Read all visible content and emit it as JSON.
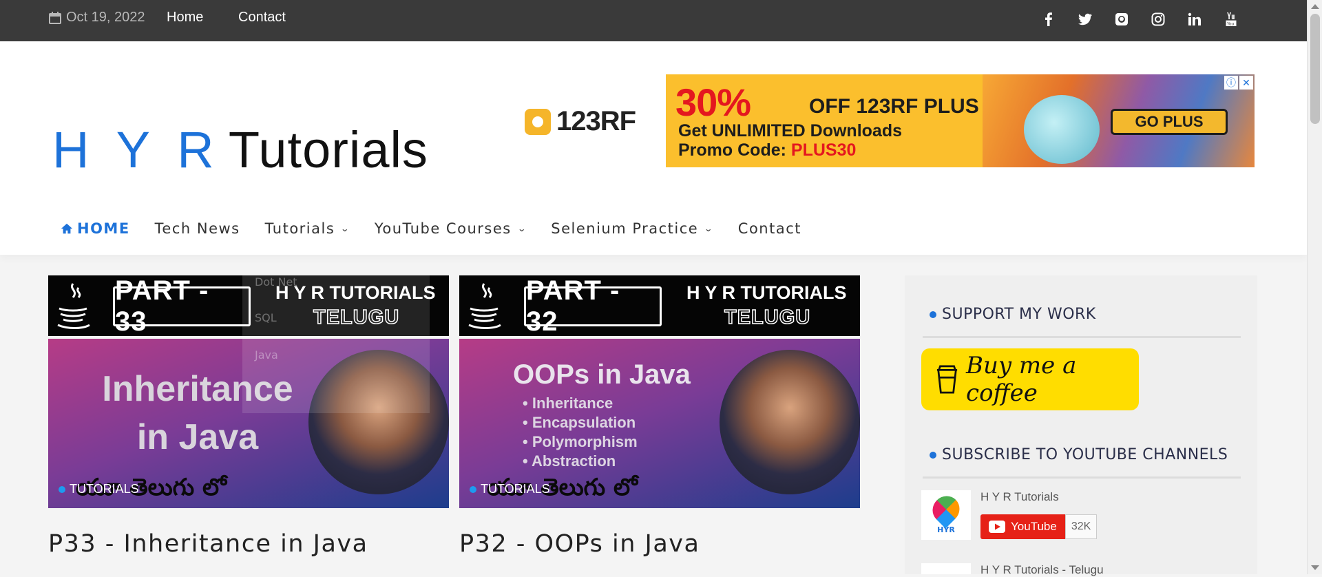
{
  "topbar": {
    "date": "Oct 19, 2022",
    "links": [
      "Home",
      "Contact"
    ],
    "social_icons": [
      "facebook-icon",
      "twitter-icon",
      "github-icon",
      "instagram-icon",
      "linkedin-icon",
      "youtube-icon"
    ]
  },
  "header": {
    "logo_hyr": "H Y R",
    "logo_tutorials": "Tutorials"
  },
  "ad": {
    "brand": "123RF",
    "discount": "30%",
    "offer": "OFF 123RF PLUS",
    "line2": "Get UNLIMITED Downloads",
    "line3_prefix": "Promo Code: ",
    "promo_code": "PLUS30",
    "cta": "GO PLUS",
    "info_icon": "ⓘ",
    "close_icon": "✕"
  },
  "nav": {
    "items": [
      {
        "label": "HOME",
        "icon": "home-icon",
        "active": true
      },
      {
        "label": "Tech News"
      },
      {
        "label": "Tutorials",
        "dropdown": true
      },
      {
        "label": "YouTube Courses",
        "dropdown": true
      },
      {
        "label": "Selenium Practice",
        "dropdown": true
      },
      {
        "label": "Contact"
      }
    ],
    "dropdown_ghost": [
      "Dot Net",
      "SQL",
      "Java"
    ]
  },
  "posts": [
    {
      "part": "PART - 33",
      "channel": "H Y R TUTORIALS",
      "language": "TELUGU",
      "thumb_title": "Inheritance in Java",
      "telugu_text": "యూ తెలుగు లో",
      "category": "TUTORIALS",
      "title": "P33 - Inheritance in Java"
    },
    {
      "part": "PART - 32",
      "channel": "H Y R TUTORIALS",
      "language": "TELUGU",
      "thumb_title": "OOPs in Java",
      "bullets": [
        "Inheritance",
        "Encapsulation",
        "Polymorphism",
        "Abstraction"
      ],
      "telugu_text": "యూ తెలుగు లో",
      "category": "TUTORIALS",
      "title": "P32 - OOPs in Java"
    }
  ],
  "sidebar": {
    "support_title": "SUPPORT MY WORK",
    "coffee_label": "Buy me a coffee",
    "subscribe_title": "SUBSCRIBE TO YOUTUBE CHANNELS",
    "channels": [
      {
        "name": "H Y R Tutorials",
        "button": "YouTube",
        "count": "32K",
        "avatar_text": "HYR"
      },
      {
        "name": "H Y R Tutorials - Telugu"
      }
    ]
  },
  "colors": {
    "accent": "#1d72d9",
    "topbar": "#3a3a3a",
    "youtube": "#e62117",
    "coffee": "#ffdd00"
  }
}
